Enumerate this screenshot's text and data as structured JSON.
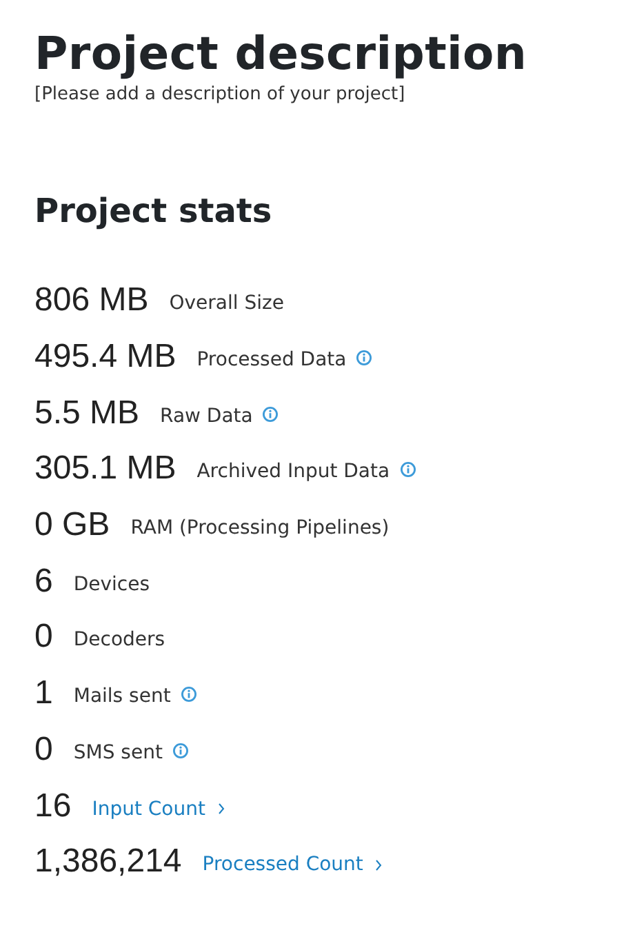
{
  "title": "Project description",
  "description": "[Please add a description of your project]",
  "stats_heading": "Project stats",
  "stats": [
    {
      "value": "806 MB",
      "label": "Overall Size",
      "kind": "plain"
    },
    {
      "value": "495.4 MB",
      "label": "Processed Data",
      "kind": "info"
    },
    {
      "value": "5.5 MB",
      "label": "Raw Data",
      "kind": "info"
    },
    {
      "value": "305.1 MB",
      "label": "Archived Input Data",
      "kind": "info"
    },
    {
      "value": "0 GB",
      "label": "RAM (Processing Pipelines)",
      "kind": "plain"
    },
    {
      "value": "6",
      "label": "Devices",
      "kind": "plain"
    },
    {
      "value": "0",
      "label": "Decoders",
      "kind": "plain"
    },
    {
      "value": "1",
      "label": "Mails sent",
      "kind": "info"
    },
    {
      "value": "0",
      "label": "SMS sent",
      "kind": "info"
    },
    {
      "value": "16",
      "label": "Input Count",
      "kind": "link"
    },
    {
      "value": "1,386,214",
      "label": "Processed Count",
      "kind": "link"
    }
  ]
}
